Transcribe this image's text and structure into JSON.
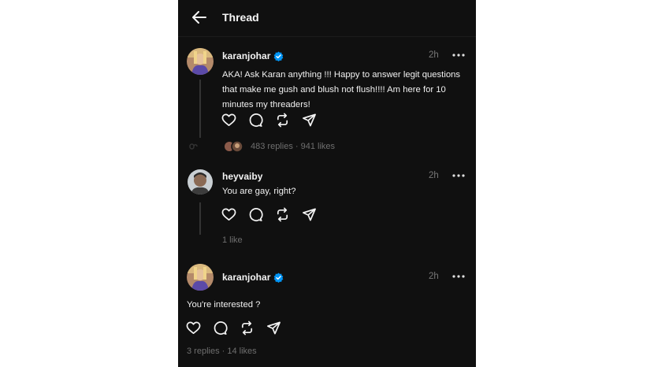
{
  "header": {
    "title": "Thread",
    "back_icon": "arrow-left-icon"
  },
  "colors": {
    "background": "#101010",
    "verified": "#0095f6",
    "text": "#f3f3f3",
    "muted": "#777777"
  },
  "posts": [
    {
      "username": "karanjohar",
      "verified": true,
      "time": "2h",
      "text": "AKA! Ask Karan anything !!! Happy to answer legit questions that make me gush and blush not flush!!!! Am here for 10 minutes my threaders!",
      "meta": "483 replies · 941 likes"
    },
    {
      "username": "heyvaiby",
      "verified": false,
      "time": "2h",
      "text": "You are gay, right?",
      "meta": "1 like"
    },
    {
      "username": "karanjohar",
      "verified": true,
      "time": "2h",
      "text": "You're interested ?",
      "meta": "3 replies · 14 likes"
    }
  ],
  "icons": [
    "heart-icon",
    "comment-icon",
    "repost-icon",
    "share-icon",
    "more-icon",
    "verified-badge-icon"
  ]
}
